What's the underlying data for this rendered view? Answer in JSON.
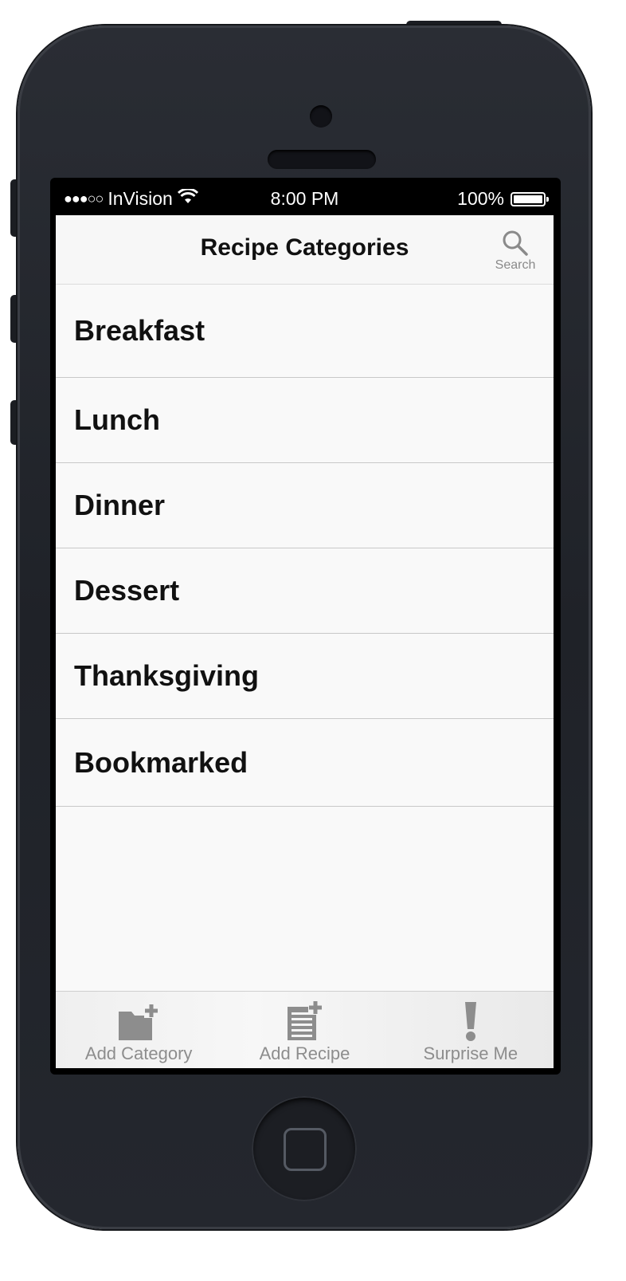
{
  "status_bar": {
    "signal": "●●●○○",
    "carrier": "InVision",
    "time": "8:00 PM",
    "battery": "100%",
    "icons": [
      "wifi-icon",
      "battery-icon"
    ]
  },
  "nav": {
    "title": "Recipe Categories",
    "search_label": "Search",
    "search_icon": "search-icon"
  },
  "categories": [
    {
      "label": "Breakfast"
    },
    {
      "label": "Lunch"
    },
    {
      "label": "Dinner"
    },
    {
      "label": "Dessert"
    },
    {
      "label": "Thanksgiving"
    },
    {
      "label": "Bookmarked"
    }
  ],
  "tabs": [
    {
      "label": "Add Category",
      "icon": "folder-add-icon"
    },
    {
      "label": "Add Recipe",
      "icon": "document-add-icon"
    },
    {
      "label": "Surprise Me",
      "icon": "exclamation-icon"
    }
  ],
  "colors": {
    "device": "#22252b",
    "screen_bg": "#f9f9f9",
    "tab_icon": "#8d8d8d",
    "text": "#111111"
  }
}
